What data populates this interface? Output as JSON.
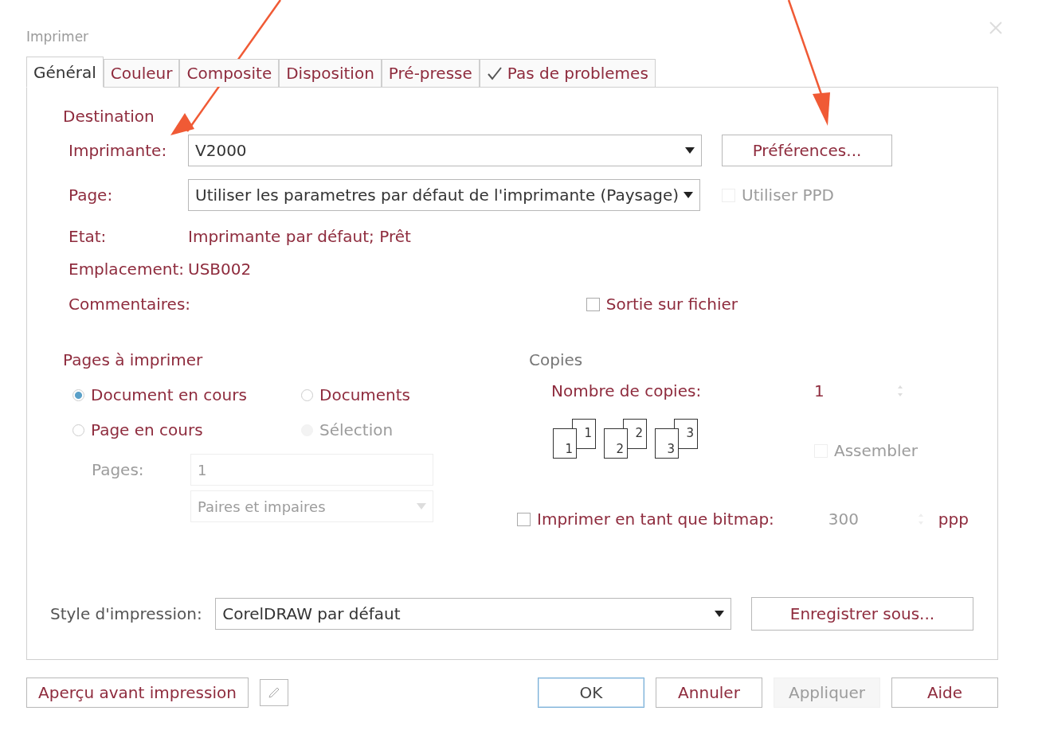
{
  "window": {
    "title": "Imprimer"
  },
  "tabs": [
    {
      "label": "Général",
      "selected": true,
      "kind": "plain"
    },
    {
      "label": "Couleur",
      "selected": false,
      "kind": "plain"
    },
    {
      "label": "Composite",
      "selected": false,
      "kind": "plain"
    },
    {
      "label": "Disposition",
      "selected": false,
      "kind": "plain"
    },
    {
      "label": "Pré-presse",
      "selected": false,
      "kind": "plain"
    },
    {
      "label": "Pas de problemes",
      "selected": false,
      "kind": "check"
    }
  ],
  "destination": {
    "heading": "Destination",
    "printer": {
      "label": "Imprimante:",
      "value": "V2000"
    },
    "preferences_button": "Préférences...",
    "page": {
      "label": "Page:",
      "value": "Utiliser les parametres par défaut de l'imprimante (Paysage)"
    },
    "use_ppd": {
      "label": "Utiliser PPD",
      "checked": false,
      "disabled": true
    },
    "status": {
      "label": "Etat:",
      "value": "Imprimante par défaut; Prêt"
    },
    "location": {
      "label": "Emplacement:",
      "value": "USB002"
    },
    "comments": {
      "label": "Commentaires:"
    },
    "output_to_file": {
      "label": "Sortie sur fichier",
      "checked": false,
      "disabled": false
    }
  },
  "pages_to_print": {
    "heading": "Pages à imprimer",
    "options": [
      {
        "label": "Document en cours",
        "selected": true,
        "disabled": false
      },
      {
        "label": "Documents",
        "selected": false,
        "disabled": false
      },
      {
        "label": "Page en cours",
        "selected": false,
        "disabled": false
      },
      {
        "label": "Sélection",
        "selected": false,
        "disabled": true
      }
    ],
    "pages_field": {
      "label": "Pages:",
      "value": "1",
      "disabled": true
    },
    "parity": {
      "value": "Paires et impaires",
      "disabled": true
    }
  },
  "copies": {
    "heading": "Copies",
    "count": {
      "label": "Nombre de copies:",
      "value": "1"
    },
    "collate_pages": [
      {
        "back": "1",
        "front": "1"
      },
      {
        "back": "2",
        "front": "2"
      },
      {
        "back": "3",
        "front": "3"
      }
    ],
    "collate": {
      "label": "Assembler",
      "checked": false,
      "disabled": true
    }
  },
  "bitmap": {
    "label": "Imprimer en tant que bitmap:",
    "checked": false,
    "resolution": "300",
    "resolution_disabled": true,
    "unit": "ppp"
  },
  "print_style": {
    "label": "Style d'impression:",
    "value": "CorelDRAW par défaut",
    "save_button": "Enregistrer sous..."
  },
  "footer": {
    "buttons": [
      {
        "label": "Aperçu avant impression",
        "kind": "left",
        "default": false,
        "disabled": false
      },
      {
        "label": "OK",
        "kind": "right",
        "default": true,
        "disabled": false
      },
      {
        "label": "Annuler",
        "kind": "right",
        "default": false,
        "disabled": false
      },
      {
        "label": "Appliquer",
        "kind": "right",
        "default": false,
        "disabled": true
      },
      {
        "label": "Aide",
        "kind": "right",
        "default": false,
        "disabled": false
      }
    ]
  }
}
